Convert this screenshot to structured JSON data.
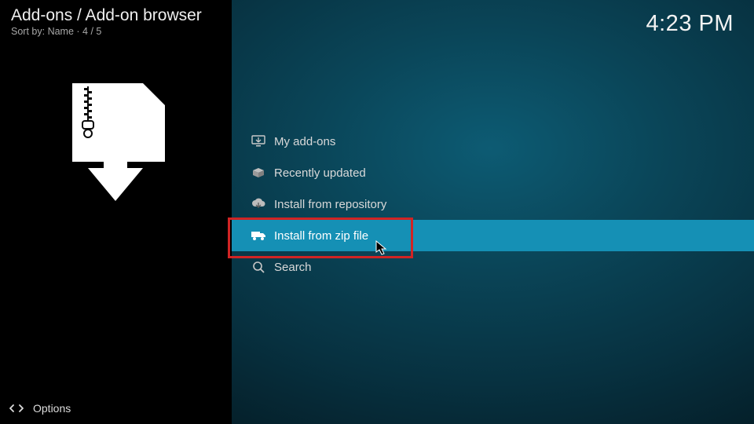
{
  "header": {
    "breadcrumb": "Add-ons / Add-on browser",
    "sort_prefix": "Sort by:",
    "sort_value": "Name",
    "position": "4 / 5"
  },
  "clock": "4:23 PM",
  "menu": {
    "items": [
      {
        "label": "My add-ons",
        "icon": "monitor-icon"
      },
      {
        "label": "Recently updated",
        "icon": "open-box-icon"
      },
      {
        "label": "Install from repository",
        "icon": "cloud-download-icon"
      },
      {
        "label": "Install from zip file",
        "icon": "truck-icon"
      },
      {
        "label": "Search",
        "icon": "search-icon"
      }
    ],
    "selected_index": 3
  },
  "footer": {
    "options_label": "Options"
  }
}
